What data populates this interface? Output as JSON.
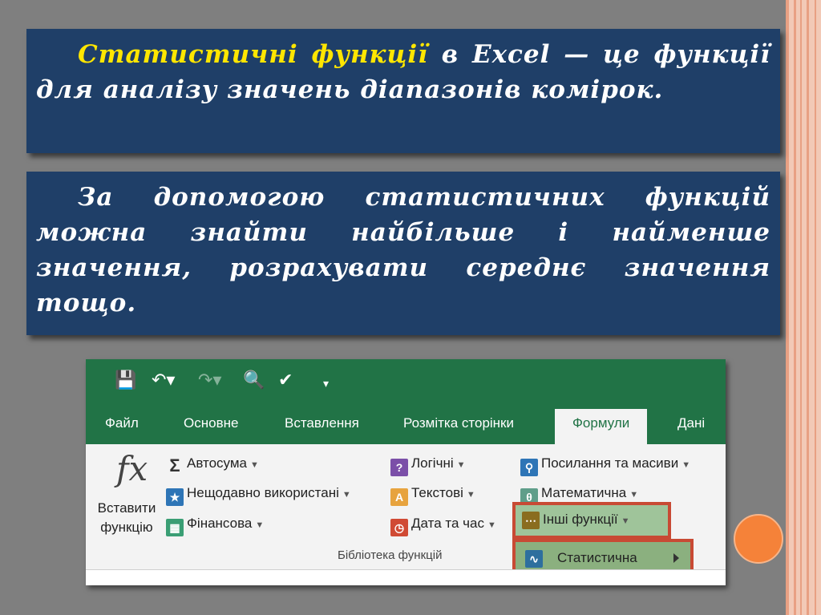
{
  "slide": {
    "para1_highlight": "Статистичні функції",
    "para1_rest": " в Excel — це функції для аналізу значень діапазонів комірок.",
    "para2": "За допомогою статистичних функцій можна знайти найбільше і найменше значення, розрахувати середнє значення тощо."
  },
  "ribbon": {
    "tabs": [
      "Файл",
      "Основне",
      "Вставлення",
      "Розмітка сторінки",
      "Формули",
      "Дані"
    ],
    "active_tab": "Формули",
    "insert_function": "Вставити функцію",
    "insert_function_line1": "Вставити",
    "insert_function_line2": "функцію",
    "fx_symbol": "fx",
    "col1": [
      "Автосума",
      "Нещодавно використані",
      "Фінансова"
    ],
    "col2": [
      "Логічні",
      "Текстові",
      "Дата та час"
    ],
    "col3": [
      "Посилання та масиви",
      "Математична",
      "Інші функції"
    ],
    "group_label": "Бібліотека функцій",
    "submenu_item": "Статистична"
  },
  "colors": {
    "text_box": "#1f3f68",
    "highlight_text": "#ffe600",
    "excel_green": "#217346",
    "highlight_border": "#c84a34"
  }
}
